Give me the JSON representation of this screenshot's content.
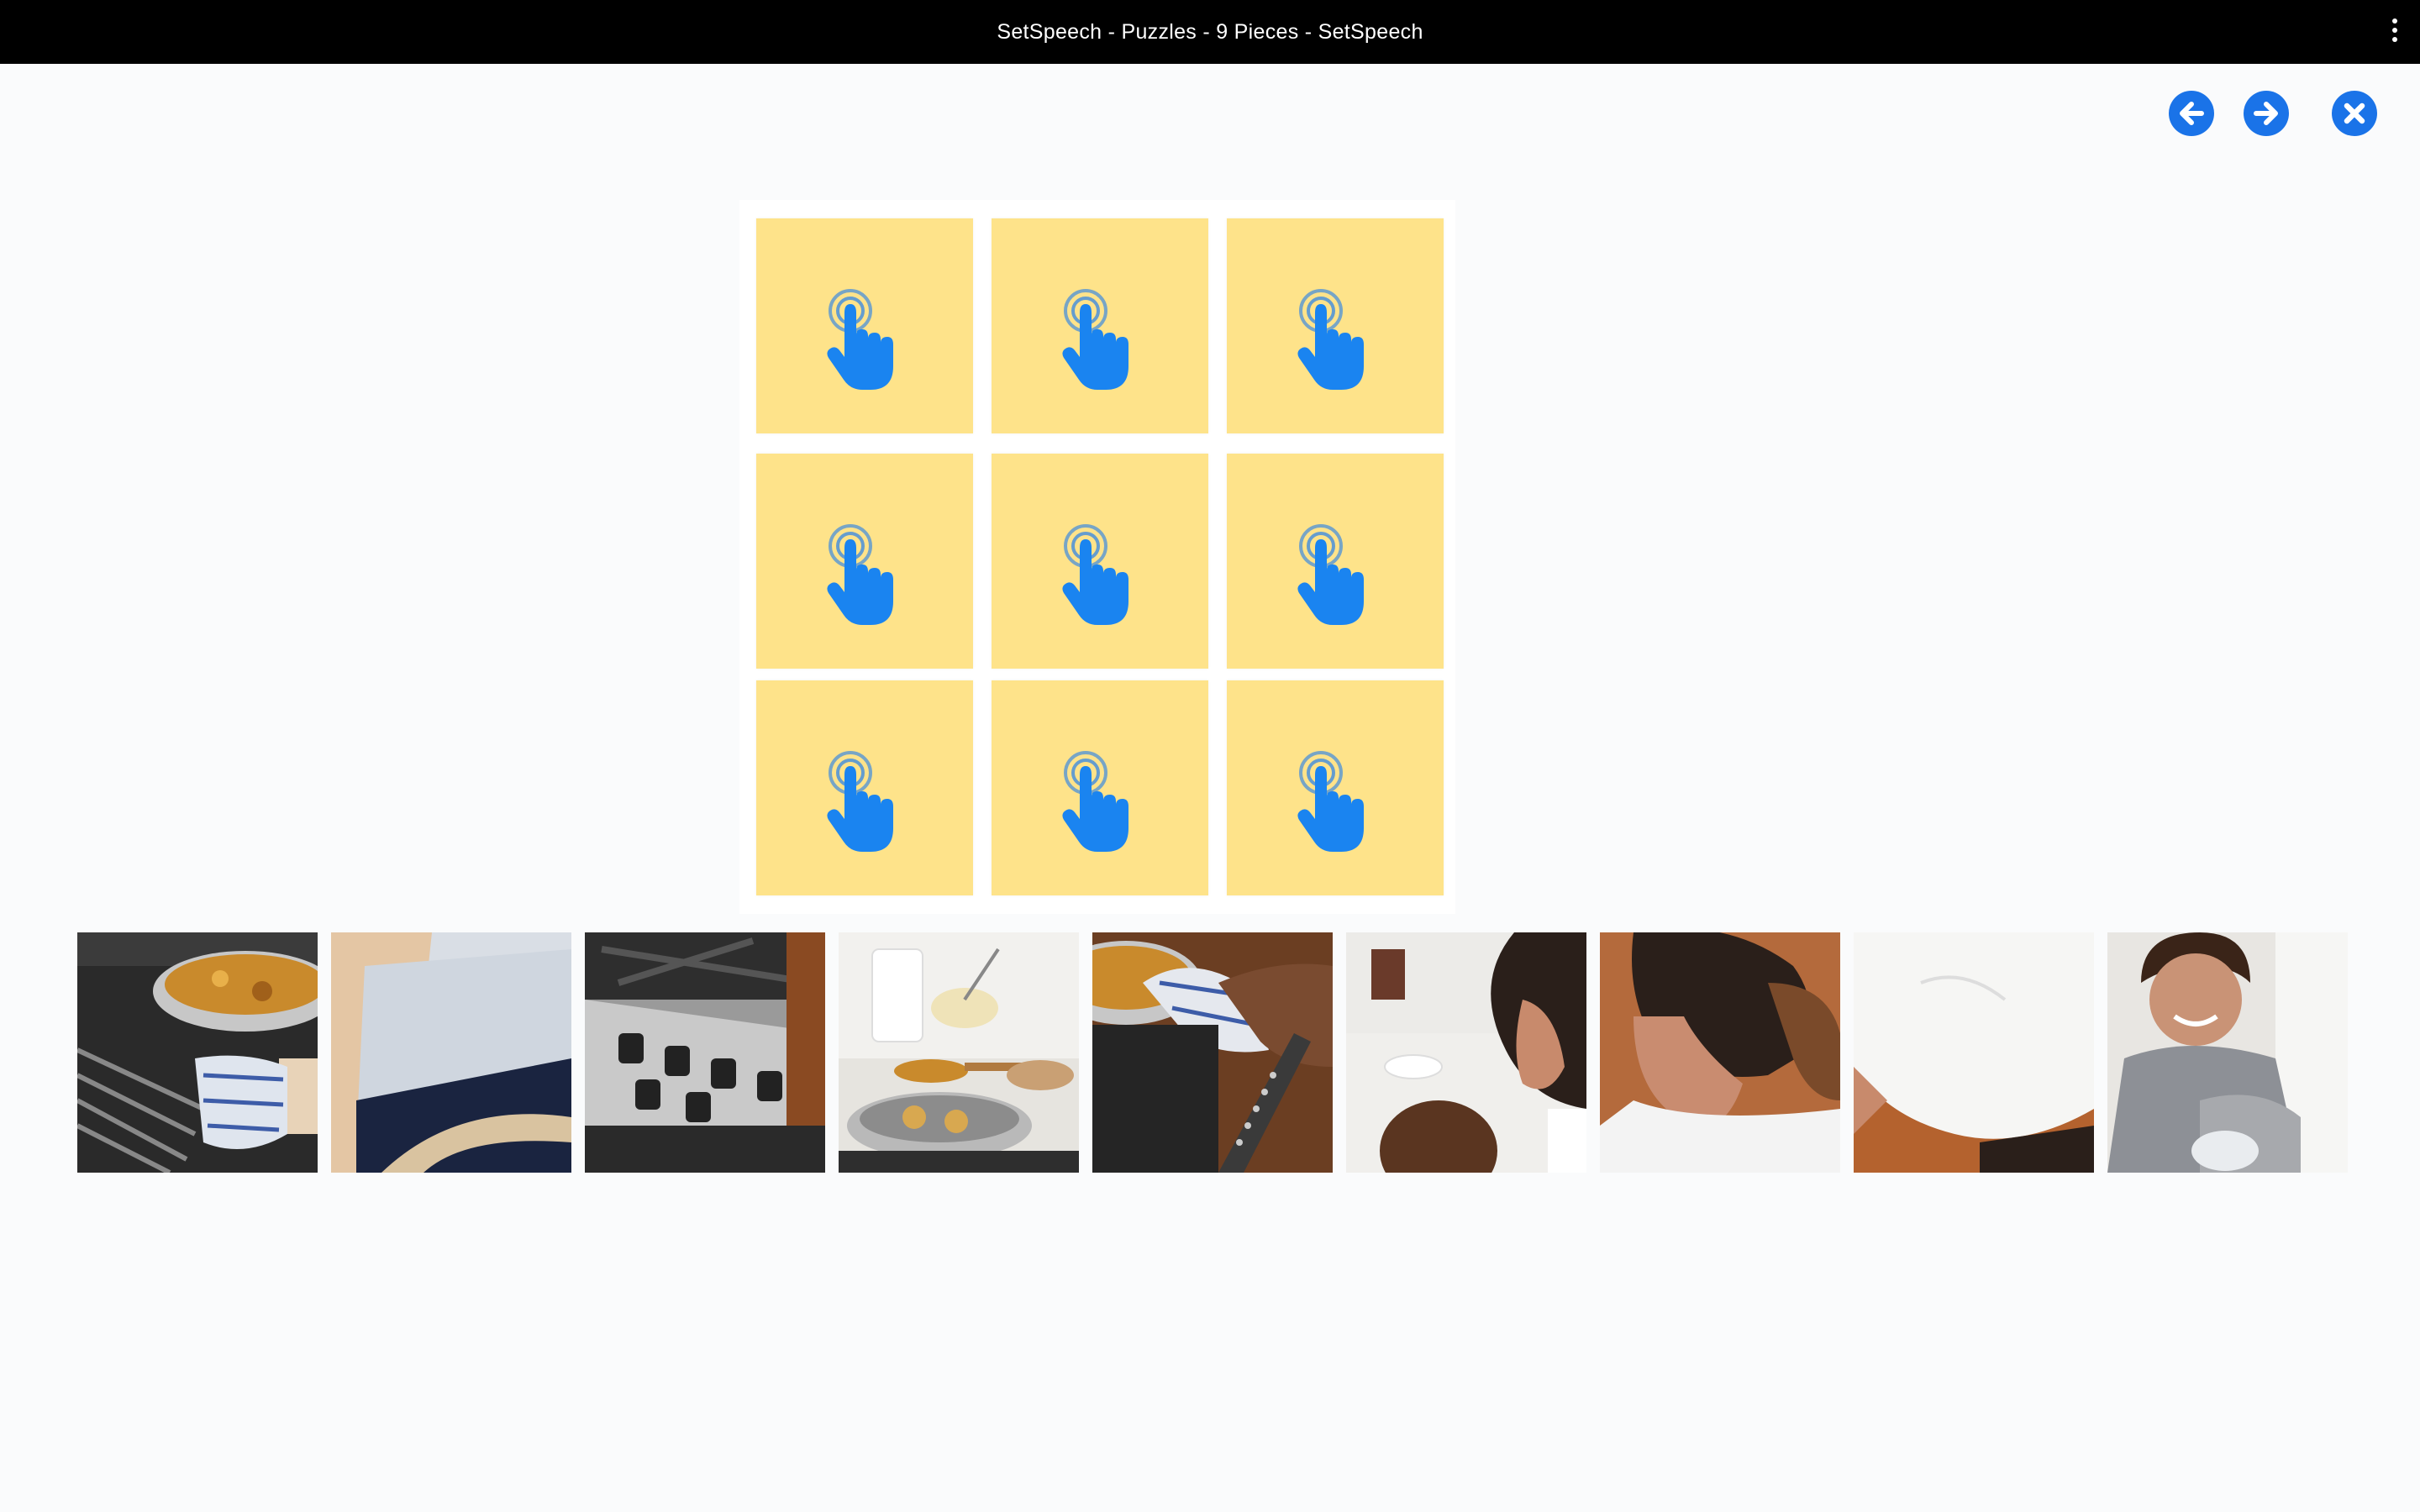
{
  "window": {
    "title": "SetSpeech - Puzzles - 9 Pieces - SetSpeech"
  },
  "toolbar": {
    "prev_icon": "arrow-left-circle-icon",
    "next_icon": "arrow-right-circle-icon",
    "close_icon": "close-circle-icon"
  },
  "colors": {
    "accent": "#1a73e8",
    "slot_bg": "#fee38a",
    "titlebar": "#000000",
    "page_bg": "#fafbfc"
  },
  "board": {
    "pieces_total": 9,
    "slot_icon": "tap-hand-icon"
  },
  "tray": {
    "pieces": [
      {
        "id": 1,
        "scene": "oven-pan-with-mitt"
      },
      {
        "id": 2,
        "scene": "oven-mitt-closeup"
      },
      {
        "id": 3,
        "scene": "stove-knobs"
      },
      {
        "id": 4,
        "scene": "counter-with-pan"
      },
      {
        "id": 5,
        "scene": "arm-holding-pan"
      },
      {
        "id": 6,
        "scene": "woman-and-child"
      },
      {
        "id": 7,
        "scene": "woman-ponytail"
      },
      {
        "id": 8,
        "scene": "white-shirt-back"
      },
      {
        "id": 9,
        "scene": "smiling-child"
      }
    ]
  }
}
